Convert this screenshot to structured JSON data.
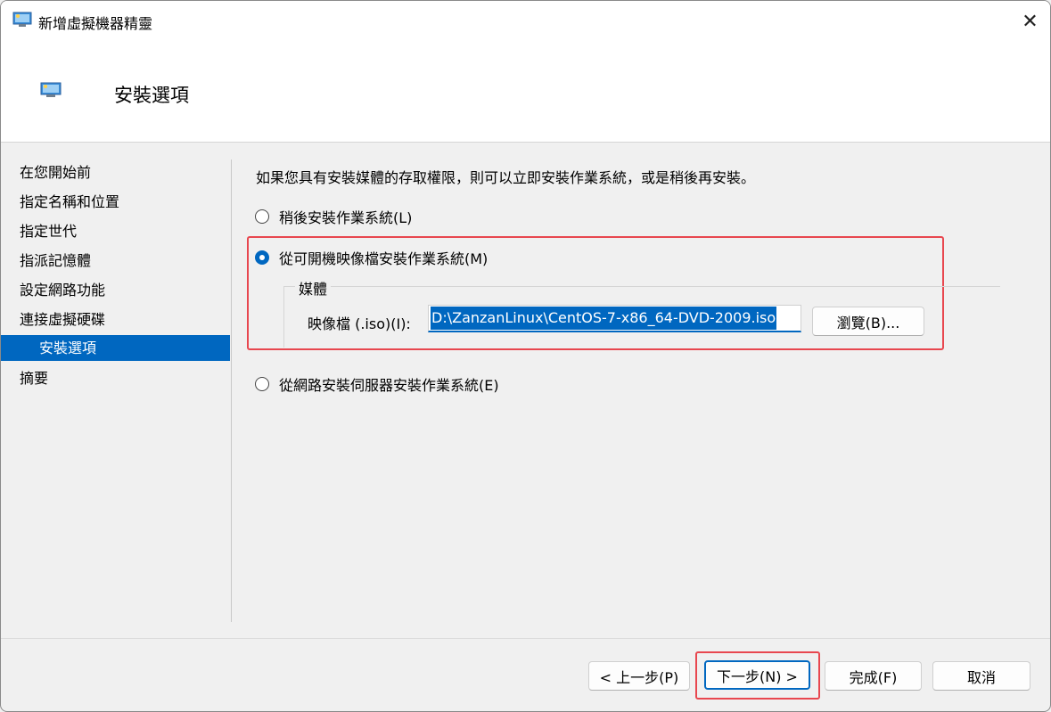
{
  "window": {
    "title": "新增虛擬機器精靈",
    "close_icon": "close-icon"
  },
  "header": {
    "title": "安裝選項"
  },
  "sidebar": {
    "items": [
      {
        "label": "在您開始前"
      },
      {
        "label": "指定名稱和位置"
      },
      {
        "label": "指定世代"
      },
      {
        "label": "指派記憶體"
      },
      {
        "label": "設定網路功能"
      },
      {
        "label": "連接虛擬硬碟"
      },
      {
        "label": "安裝選項",
        "active": true
      },
      {
        "label": "摘要"
      }
    ]
  },
  "main": {
    "intro": "如果您具有安裝媒體的存取權限，則可以立即安裝作業系統，或是稍後再安裝。",
    "option_later": "稍後安裝作業系統(L)",
    "option_bootable": "從可開機映像檔安裝作業系統(M)",
    "media_group_label": "媒體",
    "iso_label": "映像檔 (.iso)(I):",
    "iso_value": "D:\\ZanzanLinux\\CentOS-7-x86_64-DVD-2009.iso",
    "browse_label": "瀏覽(B)...",
    "option_network": "從網路安裝伺服器安裝作業系統(E)",
    "selected_option": "option_bootable"
  },
  "footer": {
    "prev_label": "< 上一步(P)",
    "next_label": "下一步(N) >",
    "finish_label": "完成(F)",
    "cancel_label": "取消"
  },
  "colors": {
    "accent": "#0067c0",
    "highlight": "#e8474f"
  }
}
